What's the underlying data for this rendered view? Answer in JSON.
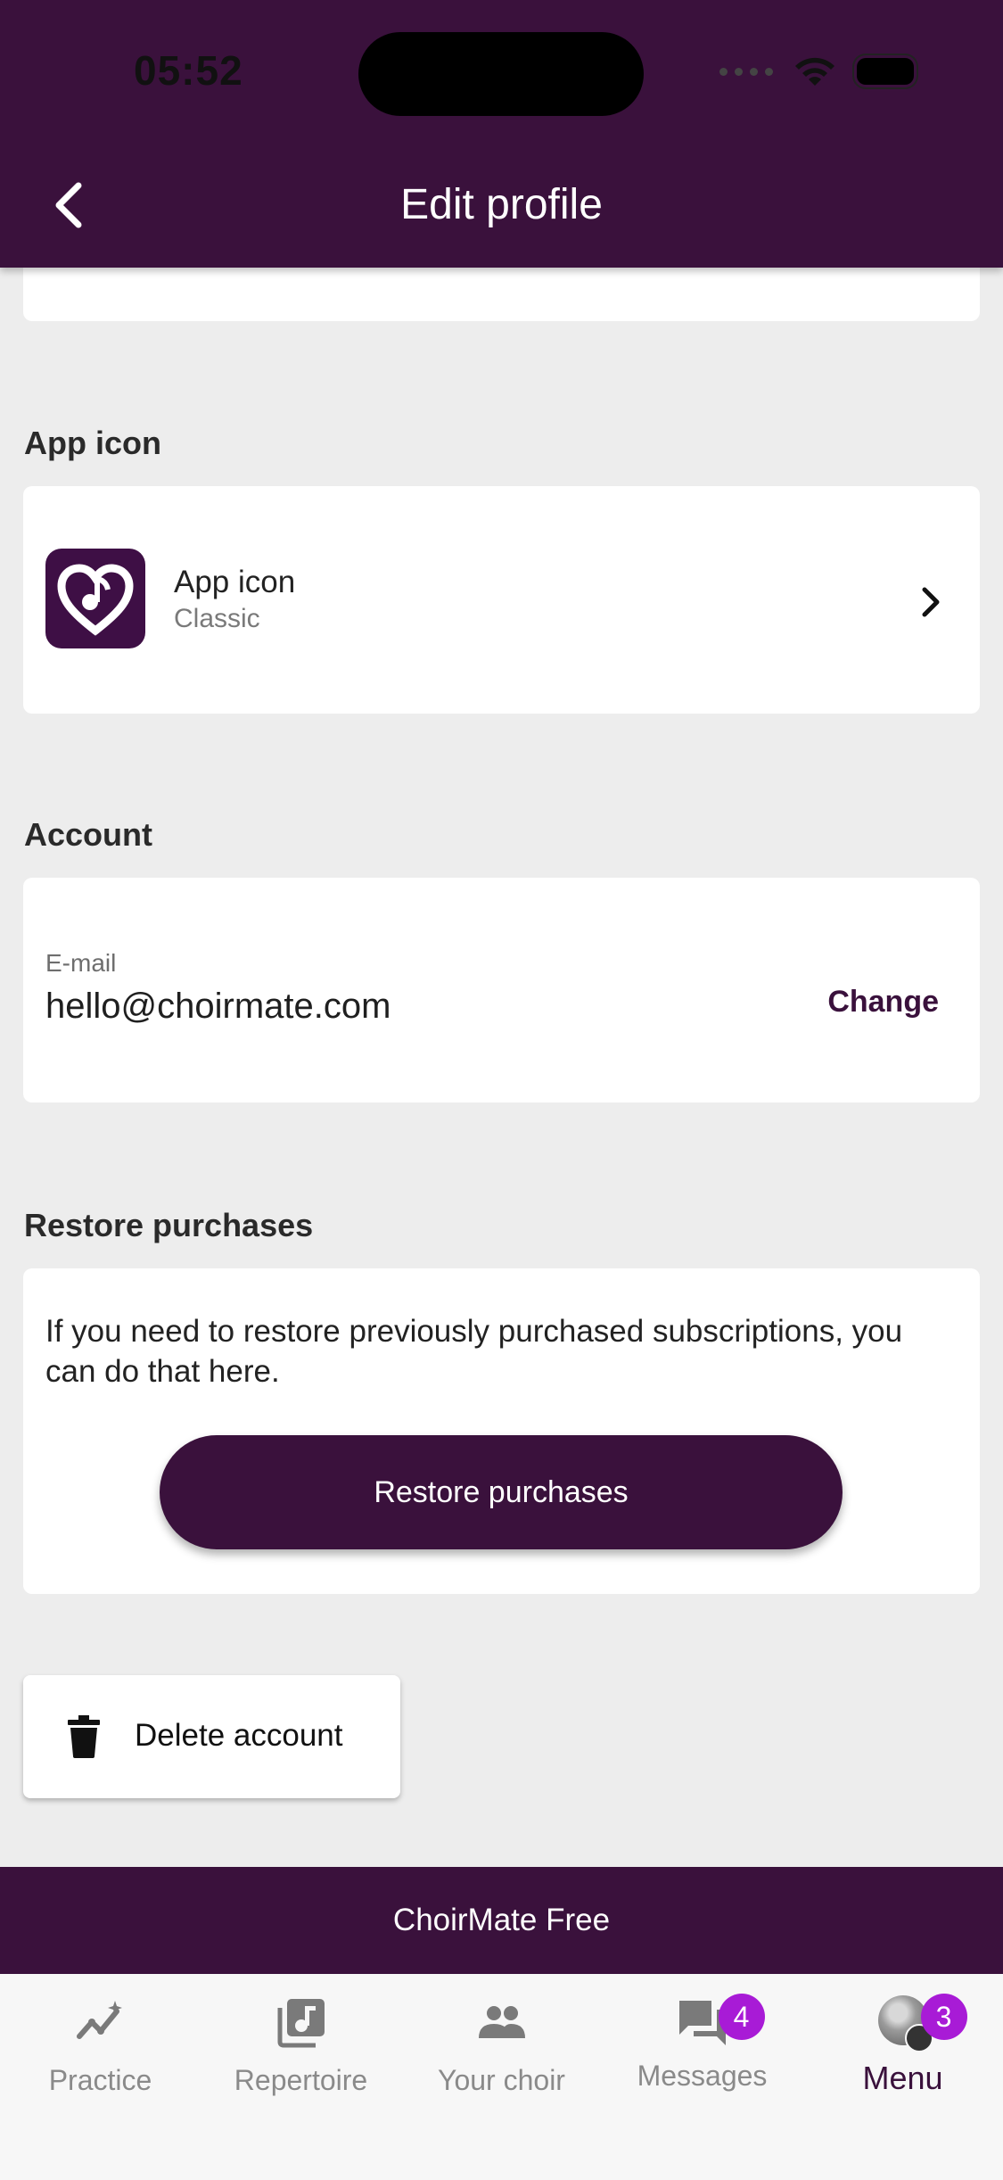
{
  "status_bar": {
    "time": "05:52"
  },
  "header": {
    "title": "Edit profile"
  },
  "app_icon_section": {
    "heading": "App icon",
    "row_title": "App icon",
    "row_subtitle": "Classic"
  },
  "account_section": {
    "heading": "Account",
    "email_label": "E-mail",
    "email_value": "hello@choirmate.com",
    "change_label": "Change"
  },
  "restore_section": {
    "heading": "Restore purchases",
    "description": "If you need to restore previously purchased subscriptions, you can do that here.",
    "button_label": "Restore purchases"
  },
  "delete_account": {
    "label": "Delete account"
  },
  "plan_banner": {
    "text": "ChoirMate Free"
  },
  "tabs": [
    {
      "label": "Practice",
      "icon": "practice-chart-icon"
    },
    {
      "label": "Repertoire",
      "icon": "music-library-icon"
    },
    {
      "label": "Your choir",
      "icon": "group-icon"
    },
    {
      "label": "Messages",
      "icon": "chat-icon",
      "badge": "4"
    },
    {
      "label": "Menu",
      "icon": "avatar",
      "badge": "3",
      "active": true
    }
  ],
  "colors": {
    "brand": "#3a113c",
    "badge": "#a81bd6",
    "background": "#ededed"
  }
}
